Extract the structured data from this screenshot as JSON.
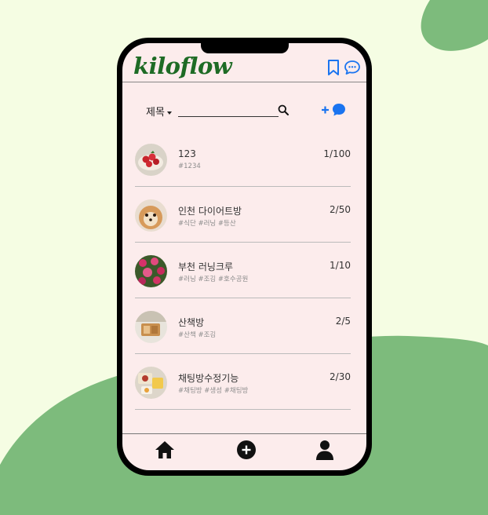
{
  "app": {
    "name": "kiloflow"
  },
  "header": {
    "icons": [
      "bookmark-icon",
      "chat-dots-icon"
    ]
  },
  "search": {
    "filter_label": "제목",
    "value": "",
    "placeholder": ""
  },
  "rooms": [
    {
      "name": "123",
      "tags": "#1234",
      "count": "1/100",
      "thumb": "strawberry-cake"
    },
    {
      "name": "인천 다이어트방",
      "tags": "#식단 #러닝 #등산",
      "count": "2/50",
      "thumb": "puppy"
    },
    {
      "name": "부천 러닝크루",
      "tags": "#러닝 #조깅 #호수공원",
      "count": "1/10",
      "thumb": "flowers"
    },
    {
      "name": "산책방",
      "tags": "#산책 #조깅",
      "count": "2/5",
      "thumb": "cafe"
    },
    {
      "name": "채팅방수정기능",
      "tags": "#채팅방 #생성 #채팅방",
      "count": "2/30",
      "thumb": "food-plate"
    }
  ],
  "tabbar": {
    "icons": [
      "home-icon",
      "plus-circle-icon",
      "user-icon"
    ]
  },
  "colors": {
    "page_bg": "#f5fde3",
    "blob": "#7dbb7c",
    "screen_bg": "#fcecec",
    "brand": "#1e6b25",
    "accent": "#1a74f0"
  }
}
